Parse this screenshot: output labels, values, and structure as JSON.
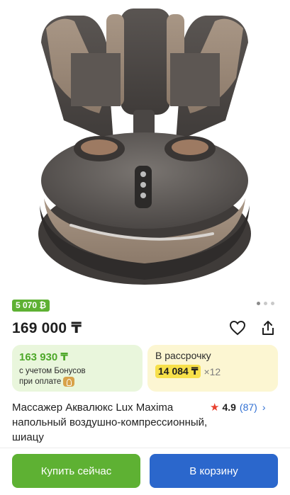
{
  "product": {
    "title": "Массажер Аквалюкс Lux Maxima напольный воздушно-компрессионный, шиацу",
    "image_icon": "foot-massager-photo",
    "bonus_badge": "5 070 ₿",
    "price": "169 000 ₸",
    "favorite_icon": "heart-outline-icon",
    "share_icon": "share-icon"
  },
  "gallery": {
    "dots": 3,
    "active_dot": 0
  },
  "bonus_card": {
    "price": "163 930 ₸",
    "line1": "с учетом Бонусов",
    "line2": "при оплате"
  },
  "installment_card": {
    "title": "В рассрочку",
    "payment": "14 084 ₸",
    "multiplier": "×12"
  },
  "rating": {
    "value": "4.9",
    "count": "(87)"
  },
  "actions": {
    "buy_now": "Купить сейчас",
    "add_to_cart": "В корзину"
  },
  "colors": {
    "green": "#5eb133",
    "blue": "#2b67cc",
    "bonus_bg": "#e9f6dc",
    "installment_bg": "#fcf6d2",
    "highlight": "#f7e04a"
  }
}
